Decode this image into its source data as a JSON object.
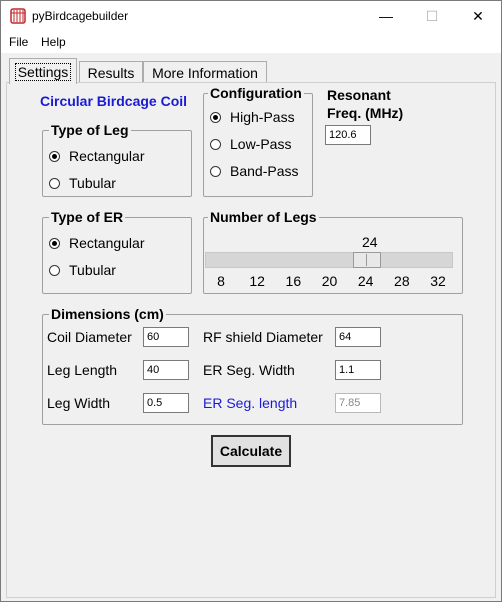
{
  "window": {
    "title": "pyBirdcagebuilder",
    "minimize": "—",
    "maximize": "☐",
    "close": "✕"
  },
  "menu": {
    "items": [
      "File",
      "Help"
    ]
  },
  "tabs": [
    {
      "label": "Settings",
      "active": true
    },
    {
      "label": "Results",
      "active": false
    },
    {
      "label": "More Information",
      "active": false
    }
  ],
  "settings": {
    "heading": "Circular Birdcage Coil",
    "type_of_leg": {
      "title": "Type of Leg",
      "options": [
        {
          "label": "Rectangular",
          "checked": true
        },
        {
          "label": "Tubular",
          "checked": false
        }
      ]
    },
    "configuration": {
      "title": "Configuration",
      "options": [
        {
          "label": "High-Pass",
          "checked": true
        },
        {
          "label": "Low-Pass",
          "checked": false
        },
        {
          "label": "Band-Pass",
          "checked": false
        }
      ]
    },
    "resonant": {
      "label_line1": "Resonant",
      "label_line2": "Freq. (MHz)",
      "value": "120.6"
    },
    "type_of_er": {
      "title": "Type of ER",
      "options": [
        {
          "label": "Rectangular",
          "checked": true
        },
        {
          "label": "Tubular",
          "checked": false
        }
      ]
    },
    "number_of_legs": {
      "title": "Number of Legs",
      "value": "24",
      "min": 8,
      "max": 32,
      "ticks": [
        "8",
        "12",
        "16",
        "20",
        "24",
        "28",
        "32"
      ]
    },
    "dimensions": {
      "title": "Dimensions (cm)",
      "coil_diameter": {
        "label": "Coil Diameter",
        "value": "60"
      },
      "leg_length": {
        "label": "Leg Length",
        "value": "40"
      },
      "leg_width": {
        "label": "Leg Width",
        "value": "0.5"
      },
      "rf_shield_diameter": {
        "label": "RF shield Diameter",
        "value": "64"
      },
      "er_seg_width": {
        "label": "ER Seg. Width",
        "value": "1.1"
      },
      "er_seg_length": {
        "label": "ER Seg. length",
        "value": "7.85"
      }
    },
    "calculate_label": "Calculate"
  },
  "colors": {
    "heading_blue": "#1a1ad4",
    "window_bg": "#f0f0f0"
  }
}
